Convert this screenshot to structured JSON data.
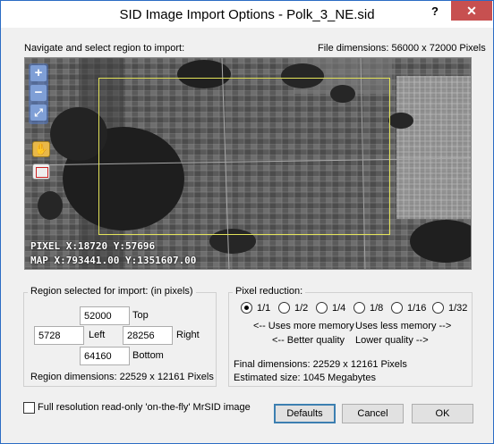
{
  "window": {
    "title": "SID Image Import Options - Polk_3_NE.sid",
    "help": "?",
    "close": "✕"
  },
  "header": {
    "instruction": "Navigate and select region to import:",
    "file_dimensions": "File dimensions:  56000 x 72000 Pixels"
  },
  "map": {
    "zoom_in": "+",
    "zoom_out": "−",
    "zoom_extent": "⤢",
    "pan_tool": "✋",
    "pixel_readout": "PIXEL  X:18720  Y:57696",
    "map_readout": "MAP  X:793441.00  Y:1351607.00"
  },
  "region": {
    "title": "Region selected for import:  (in pixels)",
    "top_value": "52000",
    "top_label": "Top",
    "left_value": "5728",
    "left_label": "Left",
    "right_value": "28256",
    "right_label": "Right",
    "bottom_value": "64160",
    "bottom_label": "Bottom",
    "dimensions": "Region dimensions:  22529 x 12161 Pixels"
  },
  "reduction": {
    "title": "Pixel reduction:",
    "options": [
      "1/1",
      "1/2",
      "1/4",
      "1/8",
      "1/16",
      "1/32"
    ],
    "selected": "1/1",
    "more_memory": "<-- Uses more memory",
    "less_memory": "Uses less memory -->",
    "better_quality": "<-- Better quality",
    "lower_quality": "Lower quality -->",
    "final_dimensions": "Final dimensions:  22529 x 12161 Pixels",
    "estimated_size": "Estimated size:   1045 Megabytes"
  },
  "footer": {
    "checkbox_label": "Full resolution read-only 'on-the-fly' MrSID image",
    "checkbox_checked": false,
    "defaults": "Defaults",
    "cancel": "Cancel",
    "ok": "OK"
  },
  "colors": {
    "selection": "#e3e35a",
    "close": "#c75050",
    "accent": "#2b6cc4"
  }
}
